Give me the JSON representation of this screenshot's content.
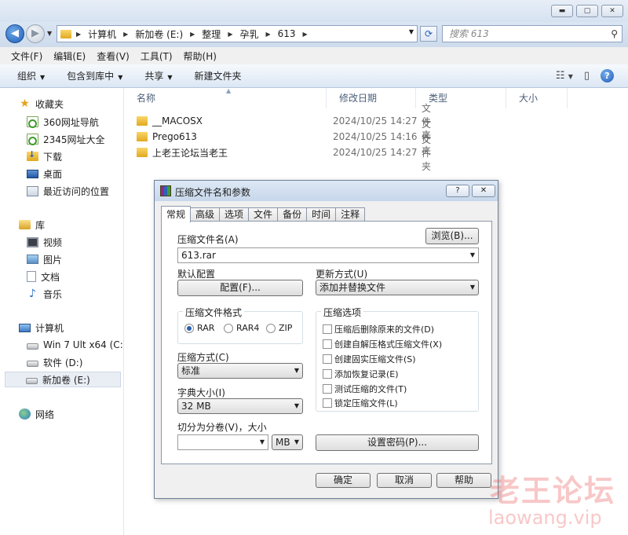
{
  "window": {
    "minimize_glyph": "▬",
    "maximize_glyph": "▢",
    "close_glyph": "✕"
  },
  "address": {
    "crumbs": [
      "计算机",
      "新加卷 (E:)",
      "整理",
      "孕乳",
      "613"
    ],
    "search_placeholder": "搜索 613"
  },
  "menubar": {
    "items": [
      "文件(F)",
      "编辑(E)",
      "查看(V)",
      "工具(T)",
      "帮助(H)"
    ]
  },
  "toolbar": {
    "organize": "组织",
    "include_library": "包含到库中",
    "share": "共享",
    "new_folder": "新建文件夹"
  },
  "sidebar": {
    "favorites_header": "收藏夹",
    "favorites": [
      "360网址导航",
      "2345网址大全",
      "下载",
      "桌面",
      "最近访问的位置"
    ],
    "libraries_header": "库",
    "libraries": [
      "视频",
      "图片",
      "文档",
      "音乐"
    ],
    "computer_header": "计算机",
    "drives": [
      "Win 7 Ult x64 (C:)",
      "软件 (D:)",
      "新加卷 (E:)"
    ],
    "network_header": "网络"
  },
  "filelist": {
    "columns": [
      "名称",
      "修改日期",
      "类型",
      "大小"
    ],
    "rows": [
      {
        "name": "__MACOSX",
        "date": "2024/10/25 14:27",
        "type": "文件夹"
      },
      {
        "name": "Prego613",
        "date": "2024/10/25 14:16",
        "type": "文件夹"
      },
      {
        "name": "上老王论坛当老王",
        "date": "2024/10/25 14:27",
        "type": "文件夹"
      }
    ]
  },
  "dialog": {
    "title": "压缩文件名和参数",
    "help_glyph": "?",
    "close_glyph": "✕",
    "tabs": [
      "常规",
      "高级",
      "选项",
      "文件",
      "备份",
      "时间",
      "注释"
    ],
    "archive_name_label": "压缩文件名(A)",
    "browse_button": "浏览(B)...",
    "archive_name_value": "613.rar",
    "default_profile_label": "默认配置",
    "profile_button": "配置(F)...",
    "update_mode_label": "更新方式(U)",
    "update_mode_value": "添加并替换文件",
    "format_group_title": "压缩文件格式",
    "formats": [
      "RAR",
      "RAR4",
      "ZIP"
    ],
    "selected_format": "RAR",
    "options_group_title": "压缩选项",
    "options": [
      "压缩后删除原来的文件(D)",
      "创建自解压格式压缩文件(X)",
      "创建固实压缩文件(S)",
      "添加恢复记录(E)",
      "测试压缩的文件(T)",
      "锁定压缩文件(L)"
    ],
    "method_label": "压缩方式(C)",
    "method_value": "标准",
    "dict_label": "字典大小(I)",
    "dict_value": "32 MB",
    "split_label": "切分为分卷(V)，大小",
    "split_value": "",
    "split_unit": "MB",
    "password_button": "设置密码(P)...",
    "ok_button": "确定",
    "cancel_button": "取消",
    "help_button": "帮助"
  },
  "watermark": {
    "line1": "老王论坛",
    "line2": "laowang.vip"
  }
}
